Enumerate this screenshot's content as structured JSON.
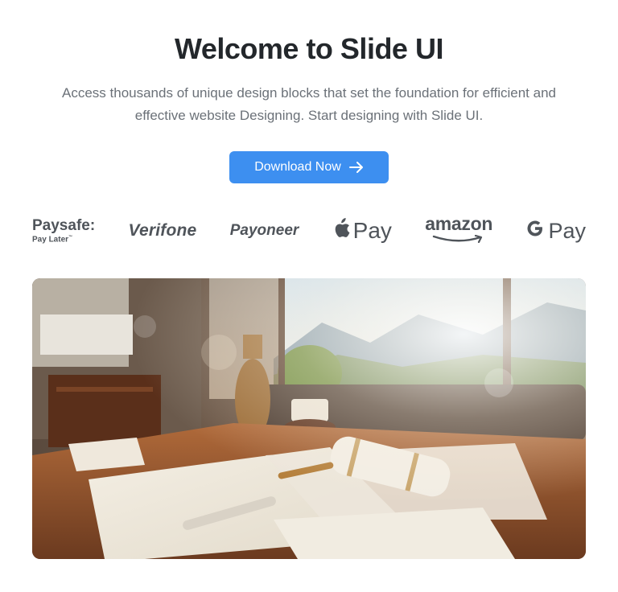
{
  "hero": {
    "title": "Welcome to Slide UI",
    "subtitle_line1": "Access thousands of unique design blocks that set the foundation for efficient and",
    "subtitle_line2": "effective website Designing. Start designing with Slide UI.",
    "cta_label": "Download Now",
    "cta_icon": "arrow-right-icon",
    "accent_color": "#3d8ff0"
  },
  "logos": {
    "paysafe": {
      "name": "Paysafe:",
      "tagline": "Pay Later"
    },
    "verifone": {
      "name": "Verifone"
    },
    "payoneer": {
      "name": "Payoneer"
    },
    "applepay": {
      "icon": "apple-icon",
      "name": "Pay"
    },
    "amazon": {
      "name": "amazon"
    },
    "gpay": {
      "icon": "google-g-icon",
      "name": "Pay"
    }
  },
  "image": {
    "description_icon": "office-desk-photo"
  }
}
